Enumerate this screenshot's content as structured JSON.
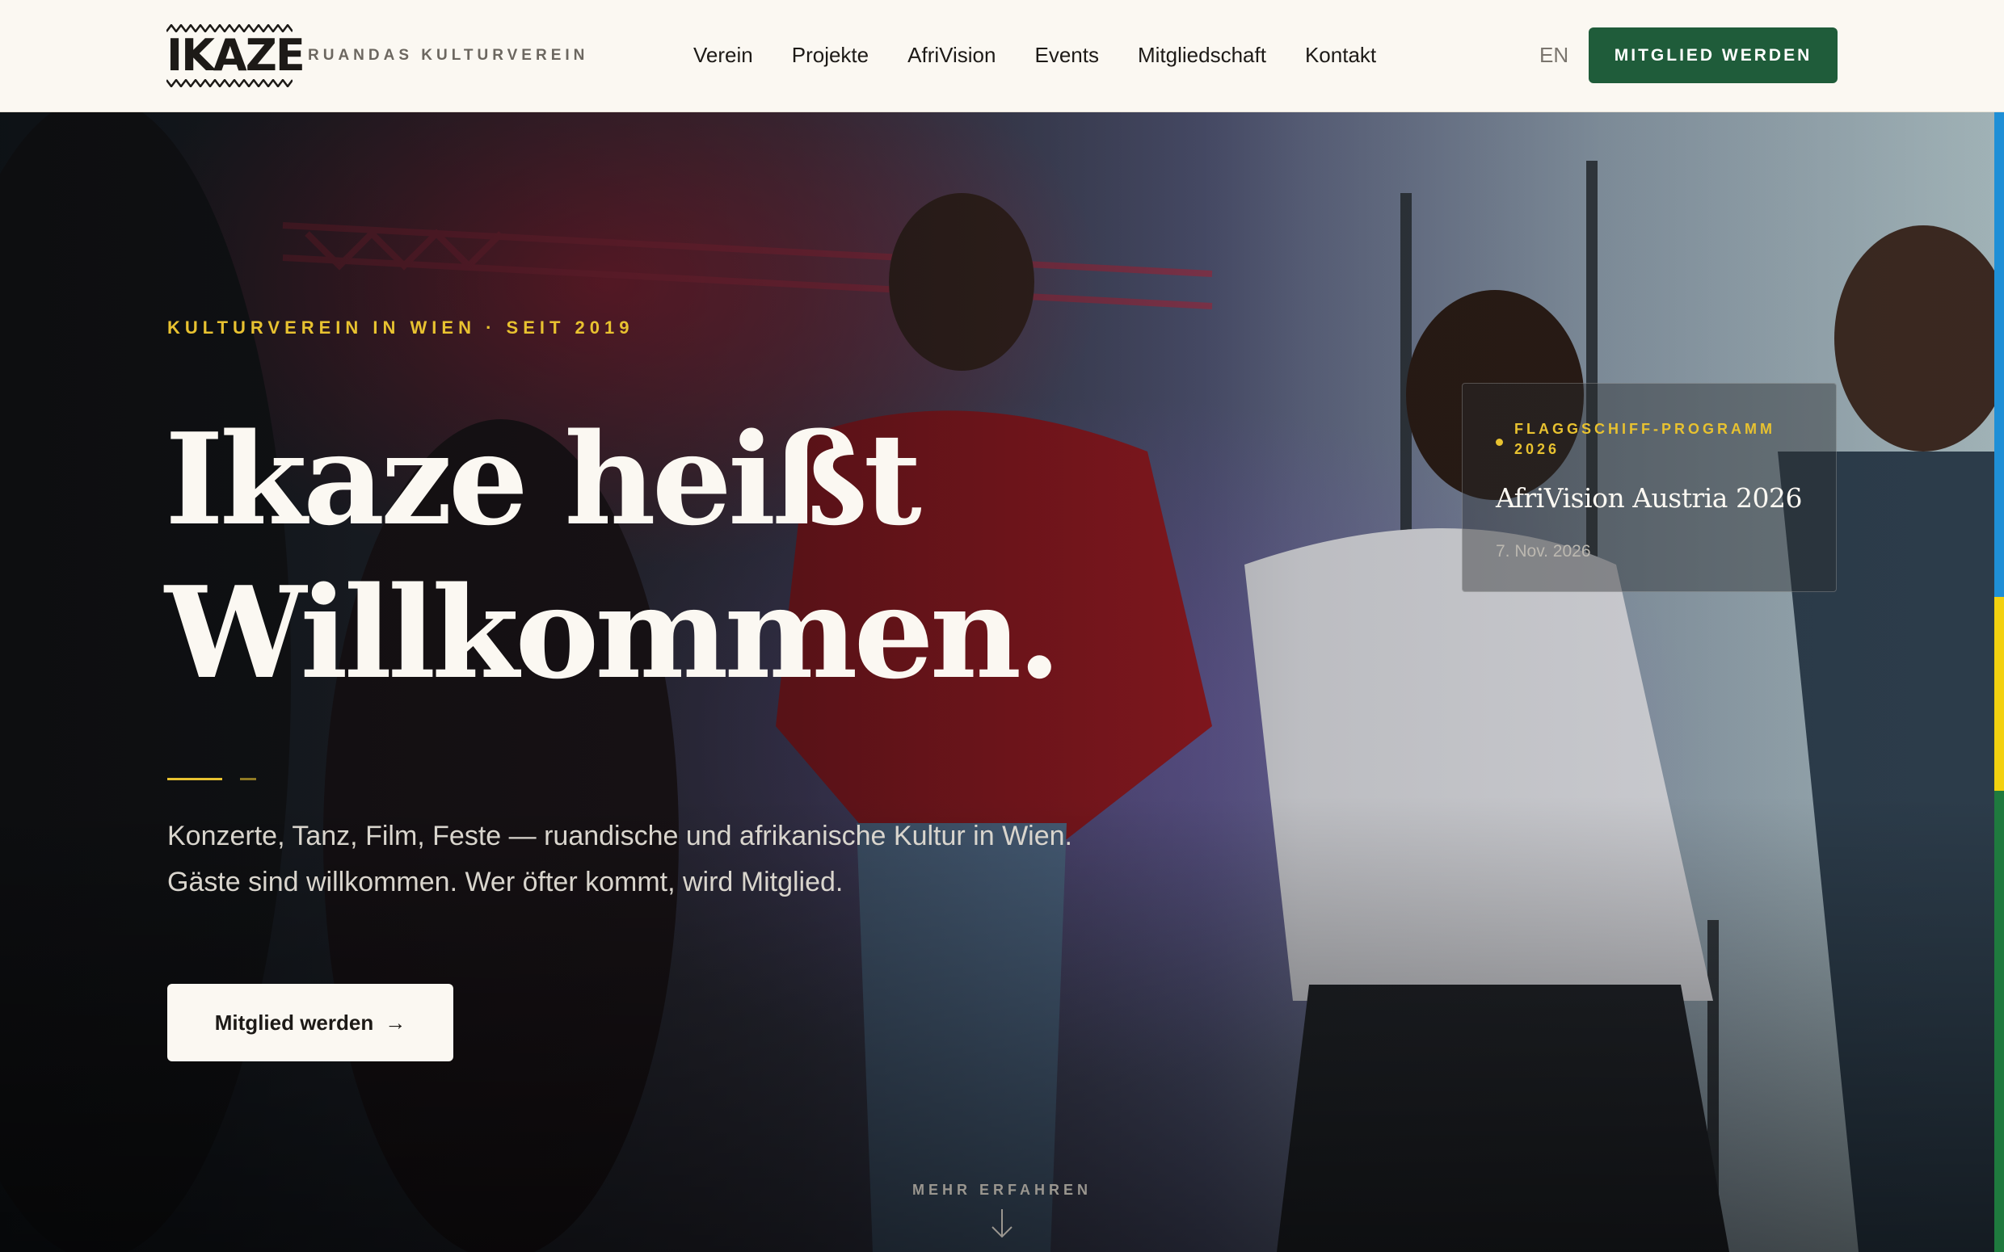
{
  "header": {
    "logo_text": "IKAZE",
    "tagline": "RUANDAS KULTURVEREIN",
    "nav": [
      {
        "label": "Verein"
      },
      {
        "label": "Projekte"
      },
      {
        "label": "AfriVision"
      },
      {
        "label": "Events"
      },
      {
        "label": "Mitgliedschaft"
      },
      {
        "label": "Kontakt"
      }
    ],
    "language": "EN",
    "cta_label": "MITGLIED WERDEN"
  },
  "hero": {
    "eyebrow": "KULTURVEREIN IN WIEN · SEIT 2019",
    "headline_line1": "Ikaze heißt",
    "headline_line2": "Willkommen.",
    "lead": "Konzerte, Tanz, Film, Feste — ruandische und afrikanische Kultur in Wien. Gäste sind willkommen. Wer öfter kommt, wird Mitglied.",
    "cta_label": "Mitglied werden",
    "cta_arrow": "→",
    "scroll_hint": "MEHR ERFAHREN"
  },
  "feature_card": {
    "eyebrow": "FLAGGSCHIFF-PROGRAMM 2026",
    "title": "AfriVision Austria 2026",
    "date": "7. Nov. 2026"
  },
  "colors": {
    "brand_green": "#1f5c3a",
    "accent_yellow": "#e8c230",
    "cream": "#fbf8f2",
    "flag_blue": "#1f8fd6",
    "flag_yellow": "#f3d10f",
    "flag_green": "#1f7a3e"
  },
  "icons": {
    "scroll": "arrow-down-icon",
    "logo_pattern": "zigzag-pattern"
  }
}
